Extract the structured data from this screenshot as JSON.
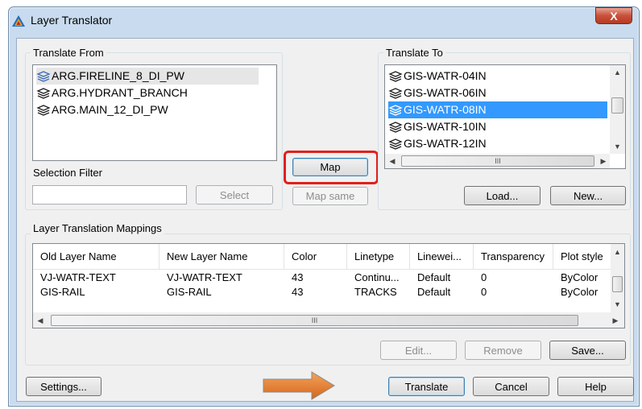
{
  "window": {
    "title": "Layer Translator",
    "close_label": "X"
  },
  "translate_from": {
    "label": "Translate From",
    "items": [
      "ARG.FIRELINE_8_DI_PW",
      "ARG.HYDRANT_BRANCH",
      "ARG.MAIN_12_DI_PW"
    ],
    "selection_filter_label": "Selection Filter",
    "filter_value": "",
    "select_button": "Select"
  },
  "center": {
    "map_button": "Map",
    "map_same_button": "Map same",
    "highlight_color": "#e0201c"
  },
  "translate_to": {
    "label": "Translate To",
    "items": [
      "GIS-WATR-04IN",
      "GIS-WATR-06IN",
      "GIS-WATR-08IN",
      "GIS-WATR-10IN",
      "GIS-WATR-12IN"
    ],
    "selected": "GIS-WATR-08IN",
    "load_button": "Load...",
    "new_button": "New...",
    "hscroll_grip": "III"
  },
  "mappings": {
    "label": "Layer Translation Mappings",
    "columns": [
      "Old Layer Name",
      "New Layer Name",
      "Color",
      "Linetype",
      "Linewei...",
      "Transparency",
      "Plot style"
    ],
    "rows": [
      [
        "VJ-WATR-TEXT",
        "VJ-WATR-TEXT",
        "43",
        "Continu...",
        "Default",
        "0",
        "ByColor"
      ],
      [
        "GIS-RAIL",
        "GIS-RAIL",
        "43",
        "TRACKS",
        "Default",
        "0",
        "ByColor"
      ]
    ],
    "edit_button": "Edit...",
    "remove_button": "Remove",
    "save_button": "Save...",
    "hscroll_grip": "III"
  },
  "footer": {
    "settings_button": "Settings...",
    "translate_button": "Translate",
    "cancel_button": "Cancel",
    "help_button": "Help",
    "arrow_color": "#e07b2a"
  },
  "icons": {
    "layer": "layers-icon",
    "app": "autocad-logo-icon"
  }
}
